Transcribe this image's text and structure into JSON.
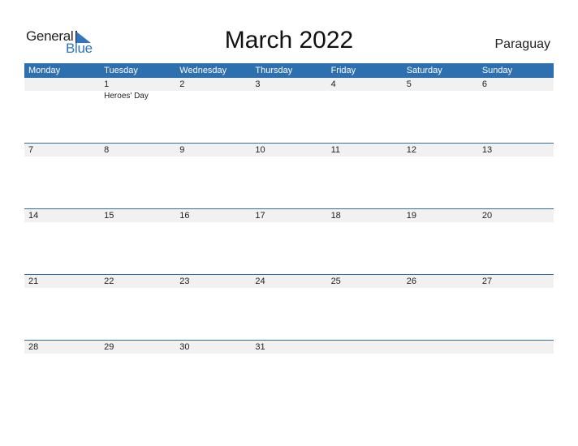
{
  "logo": {
    "general": "General",
    "blue": "Blue"
  },
  "title": "March 2022",
  "country": "Paraguay",
  "colors": {
    "header": "#2e6fb0",
    "accent": "#2f75c0",
    "row_bg": "#f1f1f1"
  },
  "weekdays": [
    "Monday",
    "Tuesday",
    "Wednesday",
    "Thursday",
    "Friday",
    "Saturday",
    "Sunday"
  ],
  "weeks": [
    {
      "days": [
        "",
        "1",
        "2",
        "3",
        "4",
        "5",
        "6"
      ],
      "events": [
        "",
        "Heroes' Day",
        "",
        "",
        "",
        "",
        ""
      ]
    },
    {
      "days": [
        "7",
        "8",
        "9",
        "10",
        "11",
        "12",
        "13"
      ],
      "events": [
        "",
        "",
        "",
        "",
        "",
        "",
        ""
      ]
    },
    {
      "days": [
        "14",
        "15",
        "16",
        "17",
        "18",
        "19",
        "20"
      ],
      "events": [
        "",
        "",
        "",
        "",
        "",
        "",
        ""
      ]
    },
    {
      "days": [
        "21",
        "22",
        "23",
        "24",
        "25",
        "26",
        "27"
      ],
      "events": [
        "",
        "",
        "",
        "",
        "",
        "",
        ""
      ]
    },
    {
      "days": [
        "28",
        "29",
        "30",
        "31",
        "",
        "",
        ""
      ],
      "events": [
        "",
        "",
        "",
        "",
        "",
        "",
        ""
      ]
    }
  ]
}
